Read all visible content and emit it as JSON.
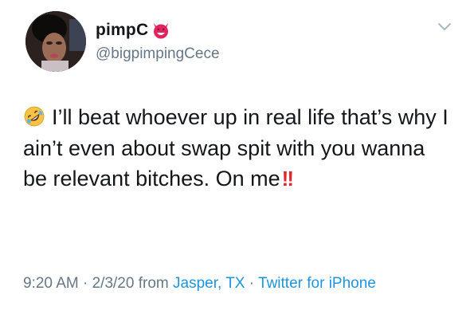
{
  "user": {
    "display_name": "pimpC",
    "handle": "@bigpimpingCece"
  },
  "icons": {
    "name_badge": "smiling-devil-icon",
    "menu": "chevron-down-icon",
    "body_emoji": "rolling-on-floor-laughing-icon"
  },
  "tweet": {
    "text": "I’ll beat whoever up in real life that’s why I ain’t even about swap spit with you wanna be relevant bitches. On me",
    "emphasis": "!!"
  },
  "meta": {
    "time": "9:20 AM",
    "sep1": " · ",
    "date": "2/3/20",
    "from_word": " from ",
    "location": "Jasper, TX",
    "sep2": " · ",
    "source": "Twitter for iPhone"
  },
  "colors": {
    "text": "#14171a",
    "muted": "#657786",
    "link": "#1b95e0",
    "emphasis": "#e0282b",
    "devil": "#e0245e"
  }
}
